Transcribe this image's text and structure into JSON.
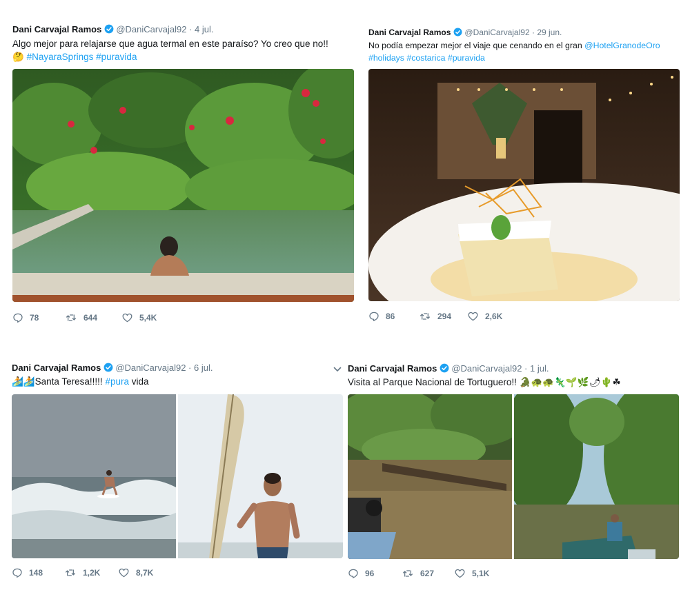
{
  "colors": {
    "link": "#1da1f2",
    "muted": "#657786",
    "text": "#14171a",
    "verified": "#1da1f2"
  },
  "tweets": [
    {
      "name": "Dani Carvajal Ramos",
      "handle": "@DaniCarvajal92",
      "sep": "·",
      "date": "4 jul.",
      "text1": "Algo mejor para relajarse que agua termal en este paraíso? Yo creo que no!!",
      "emoji": "🤔",
      "tag1": "#NayaraSprings",
      "tag2": "#puravida",
      "media_description": "pool-in-jungle-photo",
      "replies": "78",
      "retweets": "644",
      "likes": "5,4K"
    },
    {
      "name": "Dani Carvajal Ramos",
      "handle": "@DaniCarvajal92",
      "sep": "·",
      "date": "29 jun.",
      "text1": "No podía empezar mejor el viaje que cenando en el gran ",
      "mention": "@HotelGranodeOro",
      "tag1": "#holidays",
      "tag2": "#costarica",
      "tag3": "#puravida",
      "media_description": "dessert-cake-photo",
      "replies": "86",
      "retweets": "294",
      "likes": "2,6K"
    },
    {
      "name": "Dani Carvajal Ramos",
      "handle": "@DaniCarvajal92",
      "sep": "·",
      "date": "6 jul.",
      "emoji": "🏄🏄",
      "text1": "Santa Teresa!!!!! ",
      "tag1": "#pura",
      "text2": " vida",
      "media_description": "surfing-photos",
      "replies": "148",
      "retweets": "1,2K",
      "likes": "8,7K"
    },
    {
      "name": "Dani Carvajal Ramos",
      "handle": "@DaniCarvajal92",
      "sep": "·",
      "date": "1 jul.",
      "text1": "Visita al Parque Nacional de Tortuguero!! ",
      "emoji": "🐊🐢🐢🦎🌱🌿🌶🌵☘",
      "media_description": "river-jungle-photos",
      "replies": "96",
      "retweets": "627",
      "likes": "5,1K"
    }
  ]
}
